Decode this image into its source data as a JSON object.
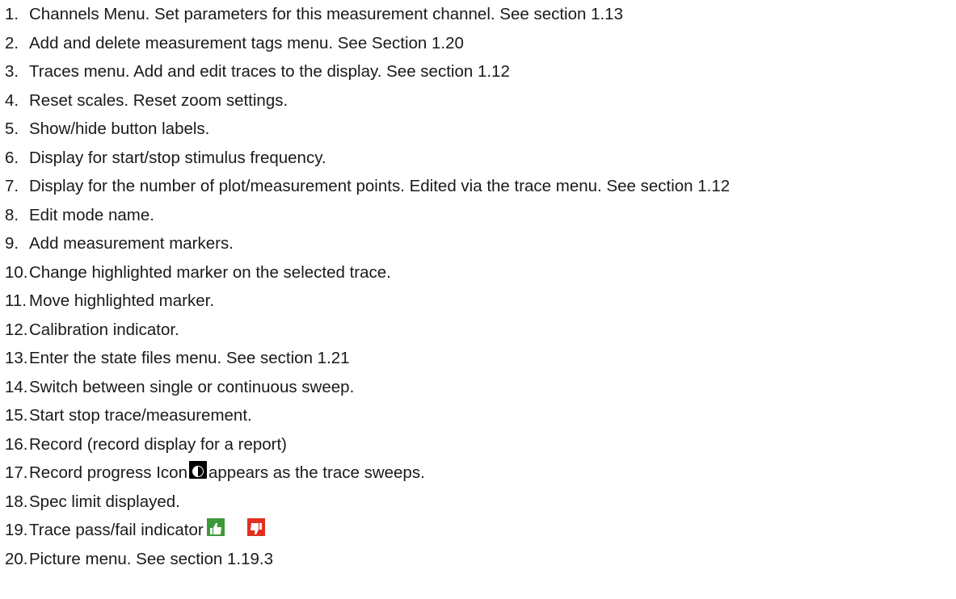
{
  "items": [
    {
      "number": "1.",
      "text": "Channels Menu. Set parameters for this measurement channel. See section 1.13"
    },
    {
      "number": "2.",
      "text": "Add and delete measurement tags menu. See Section 1.20"
    },
    {
      "number": "3.",
      "text": "Traces menu. Add and edit traces to the display. See section 1.12"
    },
    {
      "number": "4.",
      "text": "Reset scales. Reset zoom settings."
    },
    {
      "number": "5.",
      "text": "Show/hide button labels."
    },
    {
      "number": "6.",
      "text": "Display for start/stop stimulus frequency."
    },
    {
      "number": "7.",
      "text": "Display for the number of plot/measurement points. Edited via the trace menu. See section 1.12"
    },
    {
      "number": "8.",
      "text": "Edit mode name."
    },
    {
      "number": "9.",
      "text": "Add measurement markers."
    },
    {
      "number": "10.",
      "text": "Change highlighted marker on the selected trace."
    },
    {
      "number": "11.",
      "text": "Move highlighted marker."
    },
    {
      "number": "12.",
      "text": "Calibration indicator."
    },
    {
      "number": "13.",
      "text": "Enter the state files menu. See section 1.21"
    },
    {
      "number": "14.",
      "text": "Switch between single or continuous sweep."
    },
    {
      "number": "15.",
      "text": "Start stop trace/measurement."
    },
    {
      "number": "16.",
      "text": "Record (record display for a report)"
    },
    {
      "number": "17.",
      "text_before": "Record progress Icon",
      "text_after": "appears as the trace sweeps.",
      "icon": "record-progress-icon"
    },
    {
      "number": "18.",
      "text": "Spec limit displayed."
    },
    {
      "number": "19.",
      "text": "Trace pass/fail indicator",
      "icons": [
        "thumbs-up-icon",
        "thumbs-down-icon"
      ]
    },
    {
      "number": "20.",
      "text": "Picture menu. See section 1.19.3"
    }
  ],
  "colors": {
    "pass": "#3c9a3a",
    "fail": "#e03020",
    "record_icon_bg": "#000000"
  }
}
